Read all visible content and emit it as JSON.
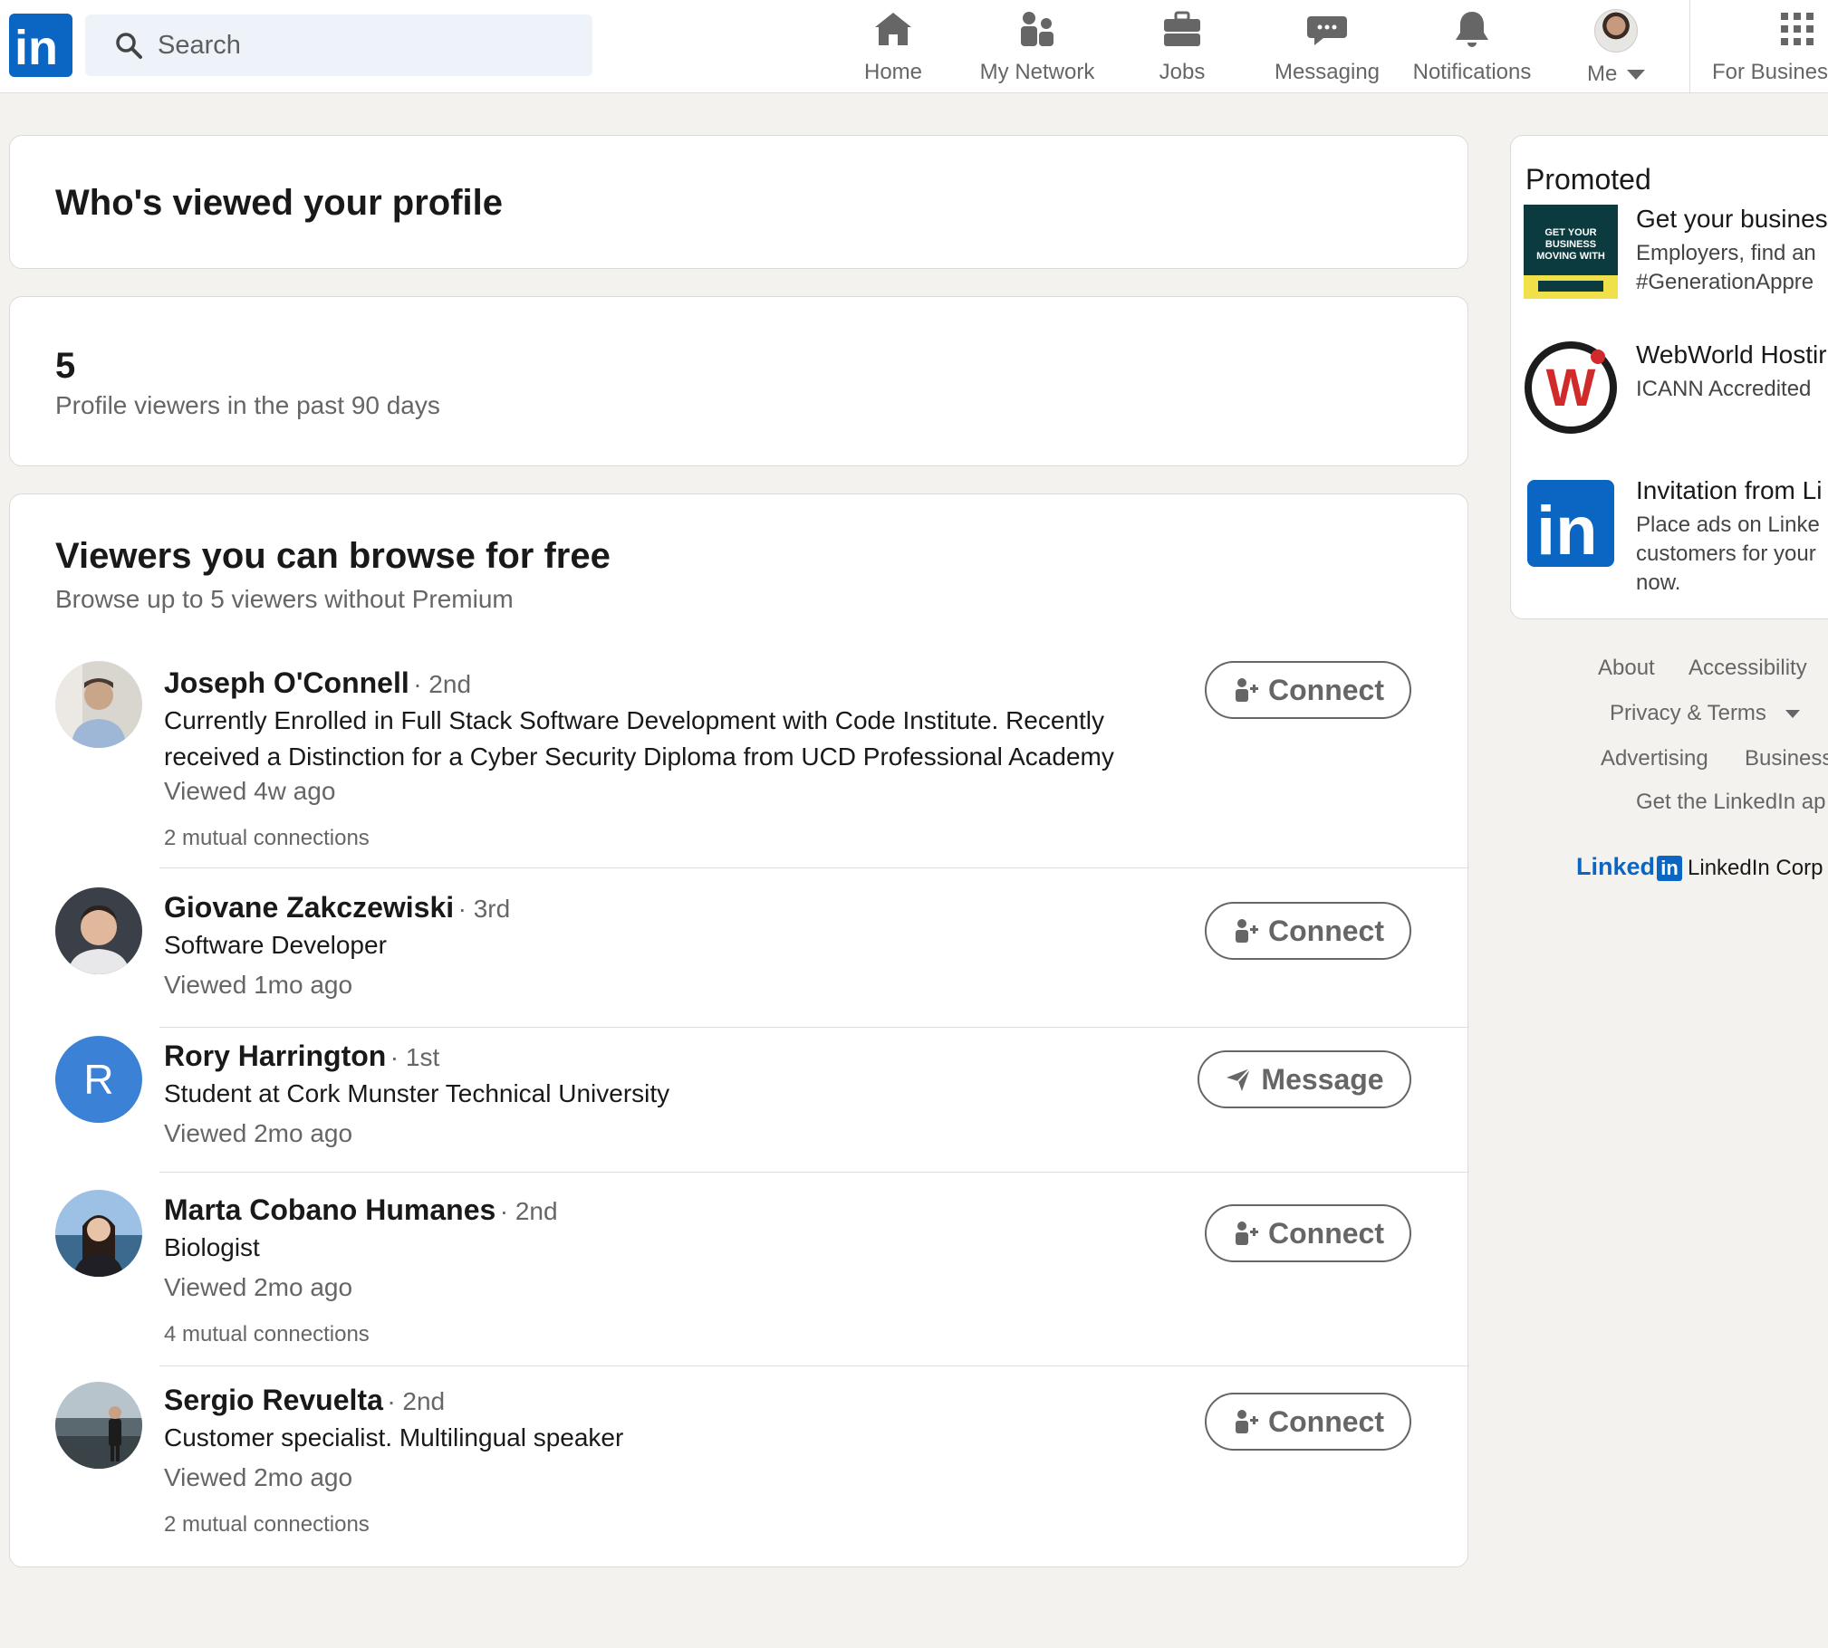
{
  "nav": {
    "search_placeholder": "Search",
    "items": [
      {
        "label": "Home",
        "icon": "home-icon"
      },
      {
        "label": "My Network",
        "icon": "network-icon"
      },
      {
        "label": "Jobs",
        "icon": "briefcase-icon"
      },
      {
        "label": "Messaging",
        "icon": "messaging-icon"
      },
      {
        "label": "Notifications",
        "icon": "bell-icon"
      },
      {
        "label": "Me",
        "icon": "avatar"
      },
      {
        "label": "For Busines",
        "icon": "grid-icon"
      }
    ]
  },
  "page_title": "Who's viewed your profile",
  "stats": {
    "count": "5",
    "description": "Profile viewers in the past 90 days"
  },
  "list": {
    "title": "Viewers you can browse for free",
    "subtitle": "Browse up to 5 viewers without Premium",
    "viewers": [
      {
        "name": "Joseph O'Connell",
        "degree": "· 2nd",
        "headline": "Currently Enrolled in Full Stack Software Development with Code Institute. Recently received a Distinction for a Cyber Security Diploma from UCD Professional Academy",
        "viewed": "Viewed 4w ago",
        "mutual": "2 mutual connections",
        "action": "Connect"
      },
      {
        "name": "Giovane Zakczewiski",
        "degree": "· 3rd",
        "headline": "Software Developer",
        "viewed": "Viewed 1mo ago",
        "mutual": "",
        "action": "Connect"
      },
      {
        "name": "Rory Harrington",
        "degree": "· 1st",
        "headline": "Student at Cork Munster Technical University",
        "viewed": "Viewed 2mo ago",
        "mutual": "",
        "action": "Message",
        "initial": "R"
      },
      {
        "name": "Marta Cobano Humanes",
        "degree": "· 2nd",
        "headline": "Biologist",
        "viewed": "Viewed 2mo ago",
        "mutual": "4 mutual connections",
        "action": "Connect"
      },
      {
        "name": "Sergio Revuelta",
        "degree": "· 2nd",
        "headline": "Customer specialist. Multilingual speaker",
        "viewed": "Viewed 2mo ago",
        "mutual": "2 mutual connections",
        "action": "Connect"
      }
    ]
  },
  "promoted": {
    "title": "Promoted",
    "ads": [
      {
        "title": "Get your busines",
        "text": "Employers, find an\n#GenerationAppre",
        "thumb_text": "GET YOUR BUSINESS MOVING WITH"
      },
      {
        "title": "WebWorld Hostir",
        "text": "ICANN Accredited",
        "thumb_text": "W"
      },
      {
        "title": "Invitation from Li",
        "text": "Place ads on Linke\ncustomers for your\nnow.",
        "thumb_text": "in"
      }
    ]
  },
  "footer": {
    "about": "About",
    "accessibility": "Accessibility",
    "privacy": "Privacy & Terms",
    "advertising": "Advertising",
    "business": "Business",
    "app": "Get the LinkedIn ap",
    "brand_word": "Linked",
    "brand_in": "in",
    "corp": "LinkedIn Corp"
  },
  "colors": {
    "brand": "#0a66c2",
    "background": "#f3f2ef",
    "initial_avatar": "#3b82d6"
  }
}
